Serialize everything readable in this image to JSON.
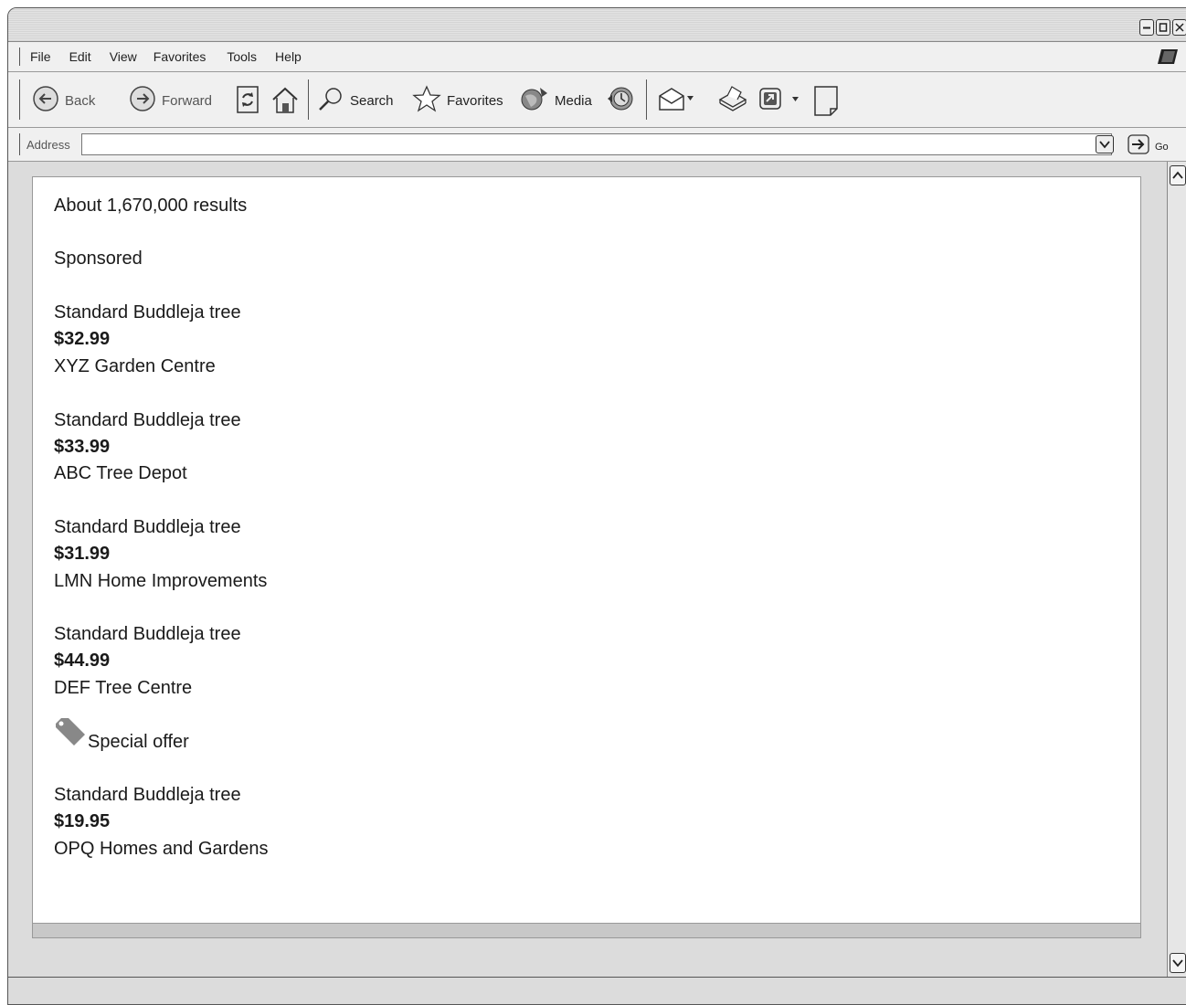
{
  "window": {
    "controls": [
      "minimize-icon",
      "restore-icon",
      "close-icon"
    ]
  },
  "menu": {
    "items": [
      "File",
      "Edit",
      "View",
      "Favorites",
      "Tools",
      "Help"
    ]
  },
  "toolbar": {
    "back_label": "Back",
    "forward_label": "Forward",
    "search_label": "Search",
    "favorites_label": "Favorites",
    "media_label": "Media",
    "icons": [
      "back-arrow-icon",
      "forward-arrow-icon",
      "refresh-icon",
      "home-icon",
      "search-icon",
      "star-icon",
      "media-icon",
      "history-icon",
      "mail-icon",
      "print-icon",
      "edit-icon",
      "page-icon"
    ]
  },
  "address": {
    "label": "Address",
    "value": "",
    "go_label": "Go"
  },
  "results": {
    "count_text": "About 1,670,000 results",
    "sponsored_label": "Sponsored",
    "special_offer_label": "Special offer",
    "listings": [
      {
        "product": "Standard Buddleja tree",
        "price": "$32.99",
        "seller": "XYZ Garden Centre"
      },
      {
        "product": "Standard Buddleja tree",
        "price": "$33.99",
        "seller": "ABC Tree Depot"
      },
      {
        "product": "Standard Buddleja tree",
        "price": "$31.99",
        "seller": "LMN Home Improvements"
      },
      {
        "product": "Standard Buddleja tree",
        "price": "$44.99",
        "seller": "DEF Tree Centre"
      },
      {
        "product": "Standard Buddleja tree",
        "price": "$19.95",
        "seller": "OPQ Homes and Gardens"
      }
    ]
  }
}
